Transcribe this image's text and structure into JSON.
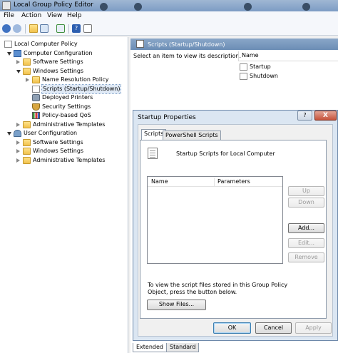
{
  "window": {
    "title": "Local Group Policy Editor"
  },
  "menu": [
    "File",
    "Action",
    "View",
    "Help"
  ],
  "toolbar": {
    "icons": [
      "back-arrow-icon",
      "forward-arrow-icon",
      "up-folder-icon",
      "show-hide-tree-icon",
      "export-list-icon",
      "help-icon",
      "properties-icon"
    ]
  },
  "tree": {
    "items": [
      {
        "label": "Local Computer Policy",
        "icon": "document-icon",
        "level": 0
      },
      {
        "label": "Computer Configuration",
        "icon": "computer-icon",
        "level": 1,
        "expanded": true
      },
      {
        "label": "Software Settings",
        "icon": "folder-icon",
        "level": 2
      },
      {
        "label": "Windows Settings",
        "icon": "folder-icon",
        "level": 2,
        "expanded": true
      },
      {
        "label": "Name Resolution Policy",
        "icon": "folder-icon",
        "level": 3
      },
      {
        "label": "Scripts (Startup/Shutdown)",
        "icon": "script-icon",
        "level": 3,
        "selected": true
      },
      {
        "label": "Deployed Printers",
        "icon": "printer-icon",
        "level": 3
      },
      {
        "label": "Security Settings",
        "icon": "shield-icon",
        "level": 3
      },
      {
        "label": "Policy-based QoS",
        "icon": "chart-icon",
        "level": 3
      },
      {
        "label": "Administrative Templates",
        "icon": "folder-icon",
        "level": 2
      },
      {
        "label": "User Configuration",
        "icon": "user-icon",
        "level": 1,
        "expanded": true
      },
      {
        "label": "Software Settings",
        "icon": "folder-icon",
        "level": 2
      },
      {
        "label": "Windows Settings",
        "icon": "folder-icon",
        "level": 2
      },
      {
        "label": "Administrative Templates",
        "icon": "folder-icon",
        "level": 2
      }
    ]
  },
  "right_pane": {
    "header": "Scripts (Startup/Shutdown)",
    "description": "Select an item to view its description.",
    "column_name": "Name",
    "items": [
      "Startup",
      "Shutdown"
    ]
  },
  "dialog": {
    "title": "Startup Properties",
    "help": "?",
    "close": "X",
    "tabs": [
      "Scripts",
      "PowerShell Scripts"
    ],
    "script_label": "Startup Scripts for Local Computer",
    "list_columns": [
      "Name",
      "Parameters"
    ],
    "buttons": {
      "up": "Up",
      "down": "Down",
      "add": "Add...",
      "edit": "Edit...",
      "remove": "Remove"
    },
    "info": "To view the script files stored in this Group Policy Object, press the button below.",
    "show_files": "Show Files...",
    "ok": "OK",
    "cancel": "Cancel",
    "apply": "Apply"
  },
  "bottom_tabs": [
    "Extended",
    "Standard"
  ]
}
